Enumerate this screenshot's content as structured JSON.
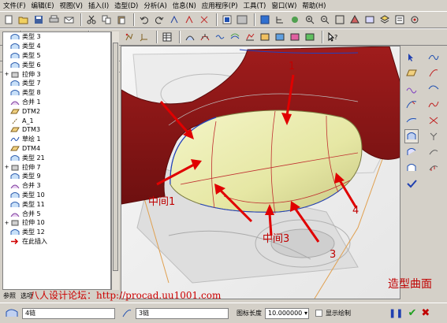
{
  "menu": [
    "文件(F)",
    "编辑(E)",
    "视图(V)",
    "插入(I)",
    "造型(D)",
    "分析(A)",
    "信息(N)",
    "应用程序(P)",
    "工具(T)",
    "窗口(W)",
    "帮助(H)"
  ],
  "panel": {
    "show_label": "显示",
    "settings_label": "设置"
  },
  "tree": [
    {
      "label": "类型 3",
      "icon": "surface-icon",
      "expand": ""
    },
    {
      "label": "类型 4",
      "icon": "surface-icon",
      "expand": ""
    },
    {
      "label": "类型 5",
      "icon": "surface-icon",
      "expand": ""
    },
    {
      "label": "类型 6",
      "icon": "surface-icon",
      "expand": ""
    },
    {
      "label": "拉伸 3",
      "icon": "extrude-icon",
      "expand": "+"
    },
    {
      "label": "类型 7",
      "icon": "surface-icon",
      "expand": ""
    },
    {
      "label": "类型 8",
      "icon": "surface-icon",
      "expand": ""
    },
    {
      "label": "合并 1",
      "icon": "merge-icon",
      "expand": ""
    },
    {
      "label": "DTM2",
      "icon": "datum-plane-icon",
      "expand": ""
    },
    {
      "label": "A_1",
      "icon": "axis-icon",
      "expand": ""
    },
    {
      "label": "DTM3",
      "icon": "datum-plane-icon",
      "expand": ""
    },
    {
      "label": "草绘 1",
      "icon": "sketch-icon",
      "expand": ""
    },
    {
      "label": "DTM4",
      "icon": "datum-plane-icon",
      "expand": ""
    },
    {
      "label": "类型 21",
      "icon": "surface-icon",
      "expand": ""
    },
    {
      "label": "拉伸 7",
      "icon": "extrude-icon",
      "expand": "+"
    },
    {
      "label": "类型 9",
      "icon": "surface-icon",
      "expand": ""
    },
    {
      "label": "合并 3",
      "icon": "merge-icon",
      "expand": ""
    },
    {
      "label": "类型 10",
      "icon": "surface-icon",
      "expand": ""
    },
    {
      "label": "类型 11",
      "icon": "surface-icon",
      "expand": ""
    },
    {
      "label": "合并 5",
      "icon": "merge-icon",
      "expand": ""
    },
    {
      "label": "拉伸 10",
      "icon": "extrude-icon",
      "expand": "+"
    },
    {
      "label": "类型 12",
      "icon": "surface-icon",
      "expand": ""
    },
    {
      "label": "在此插入",
      "icon": "insert-here-icon",
      "expand": ""
    }
  ],
  "bottom_tabs": [
    "参照",
    "选项"
  ],
  "forum": "八人设计论坛：http://procad.uu1001.com",
  "caption": "造型曲面",
  "annotations": {
    "n1": "1",
    "n3": "3",
    "n4": "4",
    "mid1": "中间1",
    "mid3": "中间3"
  },
  "status": {
    "chain1": "4链",
    "chain2": "3链",
    "length_label": "图标长度",
    "length_value": "10.000000",
    "show_plot": "显示绘制"
  },
  "colors": {
    "arrow": "#e00000",
    "surface_red": "#8b1a1a",
    "surface_yellow": "#ecedb0"
  }
}
